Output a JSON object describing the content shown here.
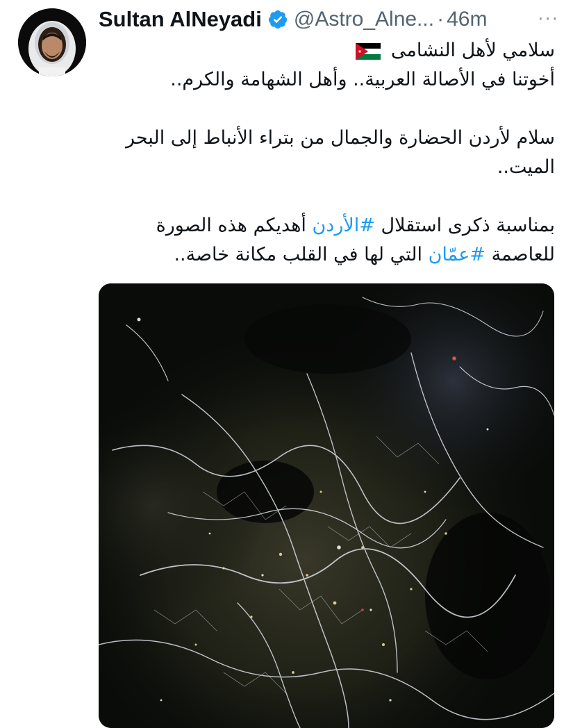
{
  "tweet": {
    "author": {
      "display_name": "Sultan AlNeyadi",
      "handle": "@Astro_Alne...",
      "verified_icon": "verified-badge-icon",
      "avatar_icon": "astronaut-avatar"
    },
    "separator": "·",
    "time": "46m",
    "more_label": "···",
    "text": {
      "line1": "سلامي لأهل النشامى",
      "line1_flag": "jordan-flag-emoji",
      "line2": "أخوتنا في الأصالة العربية.. وأهل الشهامة والكرم..",
      "line3": "سلام لأردن الحضارة والجمال من بتراء الأنباط إلى البحر الميت..",
      "line4_start": "بمناسبة ذكرى استقلال ",
      "hashtag1": "#الأردن",
      "line4_end": " أهديكم هذه الصورة للعاصمة ",
      "hashtag2": "#عمّان",
      "line4_tail": " التي لها في القلب مكانة خاصة.."
    },
    "media": {
      "icon": "amman-night-from-space-photo"
    }
  },
  "colors": {
    "text": "#0f1419",
    "secondary": "#536471",
    "link": "#1d9bf0",
    "verified": "#1d9bf0"
  }
}
